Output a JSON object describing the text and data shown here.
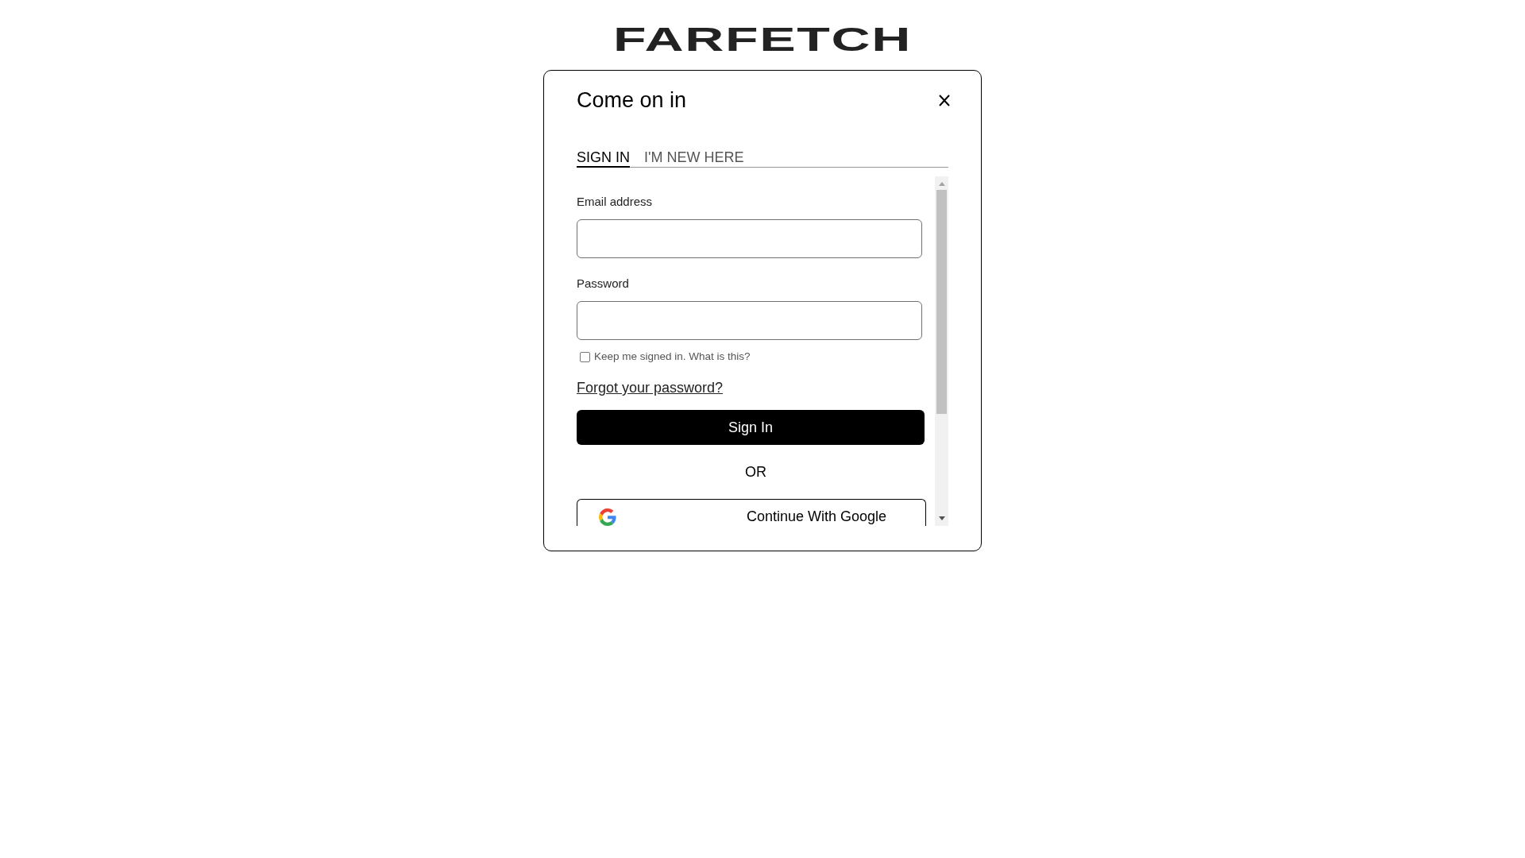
{
  "logo": {
    "text": "FARFETCH"
  },
  "dialog": {
    "title": "Come on in",
    "tabs": [
      {
        "label": "SIGN IN",
        "selected": true
      },
      {
        "label": "I'M NEW HERE",
        "selected": false
      }
    ],
    "fields": [
      {
        "label": "Email address"
      },
      {
        "label": "Password"
      }
    ],
    "keep_signed_in": {
      "label": "Keep me signed in. What is this?",
      "checked": false
    },
    "forgot_link": "Forgot your password?",
    "submit_button": "Sign In",
    "divider": "OR",
    "social_buttons": [
      {
        "label": "Continue With Google"
      }
    ]
  }
}
